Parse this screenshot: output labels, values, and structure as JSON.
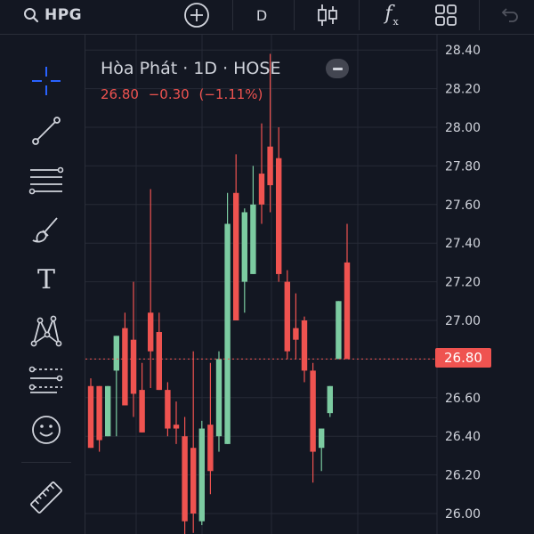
{
  "topbar": {
    "symbol": "HPG",
    "interval": "D",
    "fx_label": "f",
    "fx_sub": "x",
    "icons": [
      "search-icon",
      "add-compare-icon",
      "candlestick-chart-type-icon",
      "indicators-icon",
      "layouts-icon",
      "undo-icon"
    ]
  },
  "tools": [
    "crosshair-icon",
    "trend-line-icon",
    "fib-retracement-icon",
    "brush-icon",
    "text-tool-icon",
    "pattern-icon",
    "prediction-icon",
    "emoji-icon",
    "ruler-icon"
  ],
  "text_tool_glyph": "T",
  "legend": {
    "title": "Hòa Phát · 1D · HOSE",
    "close": "26.80",
    "change": "−0.30",
    "change_pct": "(−1.11%)"
  },
  "price_axis": {
    "ticks": [
      "28.40",
      "28.20",
      "28.00",
      "27.80",
      "27.60",
      "27.40",
      "27.20",
      "27.00",
      "26.80",
      "26.60",
      "26.40",
      "26.20",
      "26.00"
    ],
    "current_price_label": "26.80"
  },
  "colors": {
    "background": "#131722",
    "up": "#7ccba1",
    "down": "#ef5350",
    "grid": "#262a36",
    "text": "#d1d4dc"
  },
  "chart_data": {
    "type": "candlestick",
    "symbol": "HPG",
    "timeframe": "1D",
    "exchange": "HOSE",
    "ylim": [
      25.95,
      28.42
    ],
    "current_price": 26.8,
    "candles": [
      {
        "o": 26.66,
        "h": 26.7,
        "l": 26.34,
        "c": 26.34
      },
      {
        "o": 26.66,
        "h": 26.66,
        "l": 26.32,
        "c": 26.38
      },
      {
        "o": 26.4,
        "h": 26.66,
        "l": 26.4,
        "c": 26.66
      },
      {
        "o": 26.74,
        "h": 26.92,
        "l": 26.4,
        "c": 26.92
      },
      {
        "o": 26.96,
        "h": 27.04,
        "l": 26.56,
        "c": 26.56
      },
      {
        "o": 26.9,
        "h": 27.2,
        "l": 26.5,
        "c": 26.62
      },
      {
        "o": 26.64,
        "h": 26.78,
        "l": 26.42,
        "c": 26.42
      },
      {
        "o": 27.04,
        "h": 27.68,
        "l": 26.65,
        "c": 26.84
      },
      {
        "o": 26.94,
        "h": 27.04,
        "l": 26.64,
        "c": 26.64
      },
      {
        "o": 26.64,
        "h": 26.68,
        "l": 26.4,
        "c": 26.44
      },
      {
        "o": 26.46,
        "h": 26.58,
        "l": 26.36,
        "c": 26.44
      },
      {
        "o": 26.4,
        "h": 26.5,
        "l": 25.88,
        "c": 25.96
      },
      {
        "o": 26.34,
        "h": 26.84,
        "l": 25.9,
        "c": 26.0
      },
      {
        "o": 25.96,
        "h": 26.48,
        "l": 25.94,
        "c": 26.44
      },
      {
        "o": 26.46,
        "h": 26.78,
        "l": 26.1,
        "c": 26.22
      },
      {
        "o": 26.4,
        "h": 26.84,
        "l": 26.32,
        "c": 26.8
      },
      {
        "o": 26.36,
        "h": 27.66,
        "l": 26.36,
        "c": 27.5
      },
      {
        "o": 27.66,
        "h": 27.86,
        "l": 27.0,
        "c": 27.0
      },
      {
        "o": 27.2,
        "h": 27.58,
        "l": 27.04,
        "c": 27.56
      },
      {
        "o": 27.24,
        "h": 27.8,
        "l": 27.24,
        "c": 27.6
      },
      {
        "o": 27.76,
        "h": 28.02,
        "l": 27.5,
        "c": 27.6
      },
      {
        "o": 27.9,
        "h": 28.38,
        "l": 27.56,
        "c": 27.7
      },
      {
        "o": 27.84,
        "h": 28.0,
        "l": 27.2,
        "c": 27.24
      },
      {
        "o": 27.2,
        "h": 27.26,
        "l": 26.8,
        "c": 26.84
      },
      {
        "o": 26.96,
        "h": 27.14,
        "l": 26.8,
        "c": 26.9
      },
      {
        "o": 27.0,
        "h": 27.02,
        "l": 26.68,
        "c": 26.74
      },
      {
        "o": 26.74,
        "h": 26.78,
        "l": 26.16,
        "c": 26.32
      },
      {
        "o": 26.34,
        "h": 26.44,
        "l": 26.22,
        "c": 26.44
      },
      {
        "o": 26.52,
        "h": 26.66,
        "l": 26.5,
        "c": 26.66
      },
      {
        "o": 26.8,
        "h": 27.1,
        "l": 26.8,
        "c": 27.1
      },
      {
        "o": 27.3,
        "h": 27.5,
        "l": 26.8,
        "c": 26.8
      }
    ]
  }
}
